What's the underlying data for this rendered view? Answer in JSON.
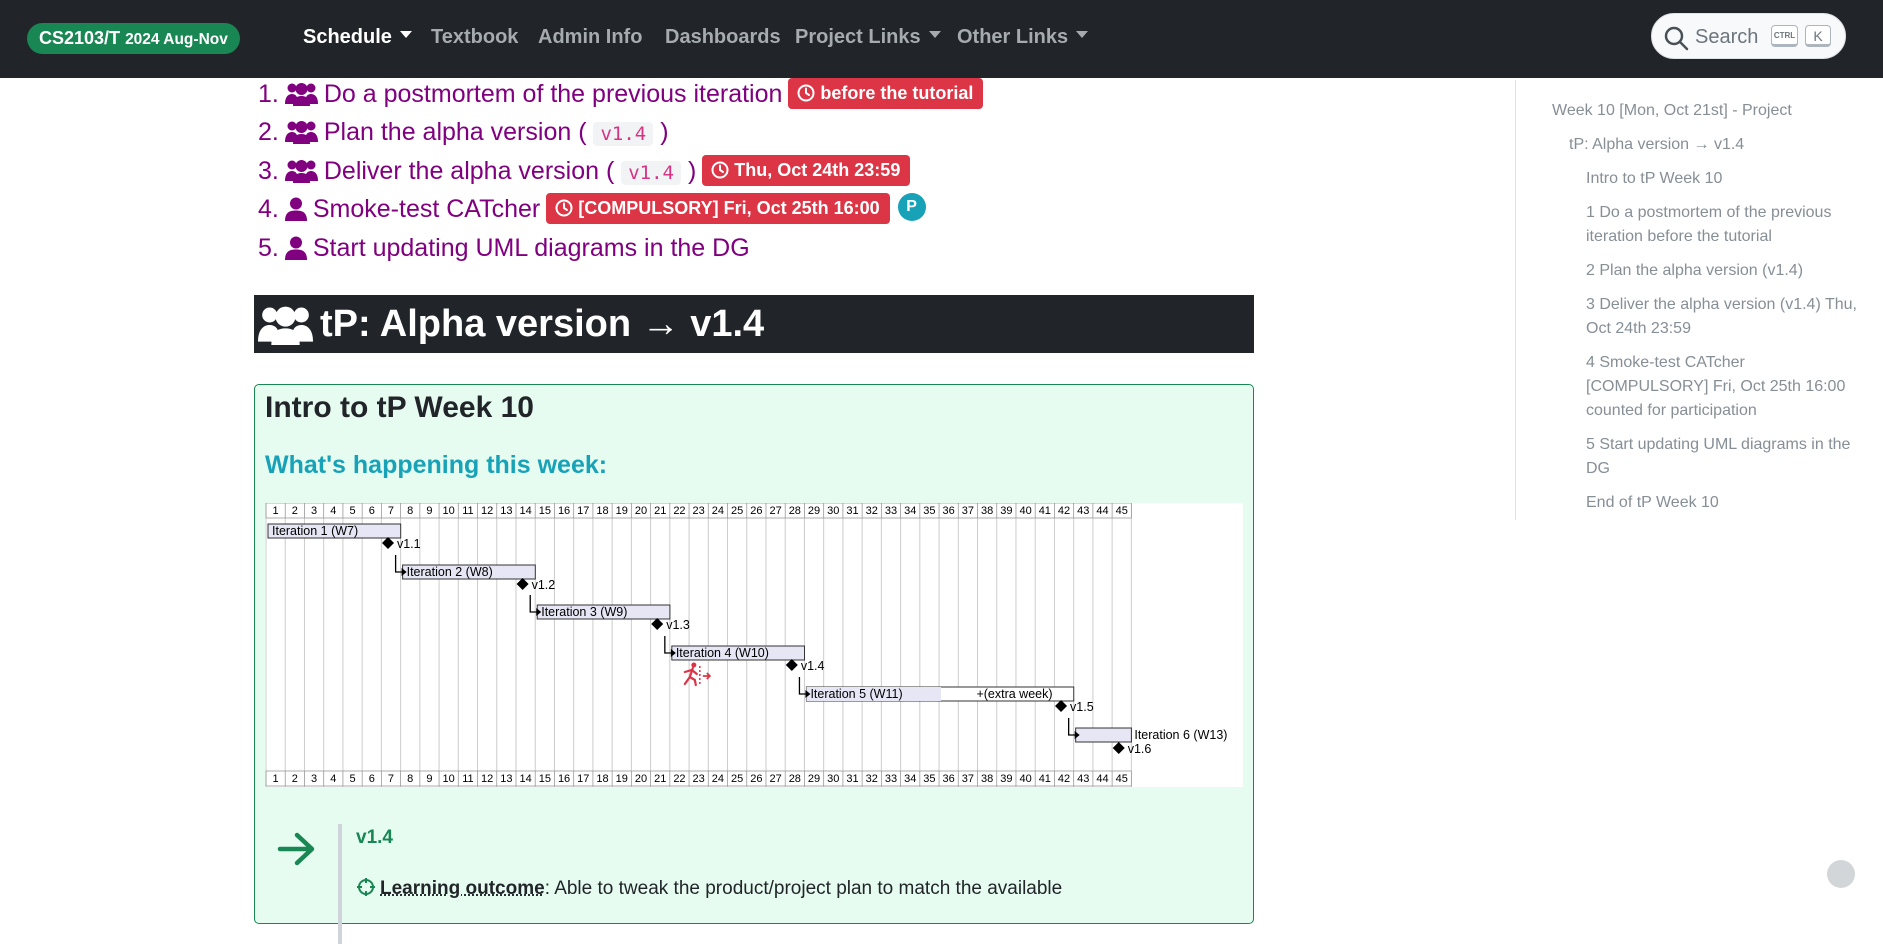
{
  "navbar": {
    "brand": "CS2103/T",
    "term": "2024 Aug-Nov",
    "items": [
      {
        "label": "Schedule",
        "dropdown": true,
        "active": true
      },
      {
        "label": "Textbook",
        "dropdown": false
      },
      {
        "label": "Admin Info",
        "dropdown": false
      },
      {
        "label": "Dashboards",
        "dropdown": false
      },
      {
        "label": "Project Links",
        "dropdown": true
      },
      {
        "label": "Other Links",
        "dropdown": true
      }
    ],
    "search": {
      "placeholder": "Search",
      "kbd_ctrl": "CTRL",
      "kbd_k": "K"
    }
  },
  "tasks": [
    {
      "num": "1.",
      "icon": "users-icon",
      "title": "Do a postmortem of the previous iteration",
      "badge": "before the tutorial"
    },
    {
      "num": "2.",
      "icon": "users-icon",
      "title_pre": "Plan the alpha version (",
      "code": "v1.4",
      "title_post": ")"
    },
    {
      "num": "3.",
      "icon": "users-icon",
      "title_pre": "Deliver the alpha version (",
      "code": "v1.4",
      "title_post": ")",
      "badge": "Thu, Oct 24th 23:59"
    },
    {
      "num": "4.",
      "icon": "user-icon",
      "title": "Smoke-test CATcher",
      "badge": "[COMPULSORY] Fri, Oct 25th 16:00",
      "participation_badge": "P"
    },
    {
      "num": "5.",
      "icon": "user-icon",
      "title": "Start updating UML diagrams in the DG"
    }
  ],
  "section": {
    "title": "tP: Alpha version → v1.4"
  },
  "intro": {
    "title": "Intro to tP Week 10",
    "subtitle": "What's happening this week:",
    "timeline": {
      "weeks": [
        "1",
        "2",
        "3",
        "4",
        "5",
        "6",
        "7",
        "8",
        "9",
        "10",
        "11",
        "12",
        "13",
        "14",
        "15",
        "16",
        "17",
        "18",
        "19",
        "20",
        "21",
        "22",
        "23",
        "24",
        "25",
        "26",
        "27",
        "28",
        "29",
        "30",
        "31",
        "32",
        "33",
        "34",
        "35",
        "36",
        "37",
        "38",
        "39",
        "40",
        "41",
        "42",
        "43",
        "44",
        "45"
      ],
      "iterations": [
        {
          "label": "Iteration 1 (W7)"
        },
        {
          "label": "Iteration 2 (W8)"
        },
        {
          "label": "Iteration 3 (W9)"
        },
        {
          "label": "Iteration 4 (W10)"
        },
        {
          "label": "Iteration 5 (W11)",
          "extra": "+(extra week)"
        },
        {
          "label": "Iteration 6 (W13)"
        }
      ],
      "milestones": [
        "v1.1",
        "v1.2",
        "v1.3",
        "v1.4",
        "v1.5",
        "v1.6"
      ]
    },
    "callout": {
      "title": "v1.4",
      "outcome_label": "Learning outcome",
      "outcome_text": ": Able to tweak the product/project plan to match the available"
    }
  },
  "toc": [
    {
      "label": "Week 10 [Mon, Oct 21st] - Project",
      "level": 0
    },
    {
      "label": "tP: Alpha version → v1.4",
      "level": 1
    },
    {
      "label": "Intro to tP Week 10",
      "level": 2
    },
    {
      "label": "1 Do a postmortem of the previous iteration before the tutorial",
      "level": 2
    },
    {
      "label": "2 Plan the alpha version (v1.4)",
      "level": 2
    },
    {
      "label": "3 Deliver the alpha version (v1.4) Thu, Oct 24th 23:59",
      "level": 2
    },
    {
      "label": "4 Smoke-test CATcher [COMPULSORY] Fri, Oct 25th 16:00 counted for participation",
      "level": 2
    },
    {
      "label": "5 Start updating UML diagrams in the DG",
      "level": 2
    },
    {
      "label": "End of tP Week 10",
      "level": 2
    }
  ],
  "colors": {
    "brand": "#198754",
    "deadline": "#dc3545",
    "task_link": "#800080",
    "subtitle": "#17a2b8",
    "box_bg": "#e6fcf0"
  }
}
